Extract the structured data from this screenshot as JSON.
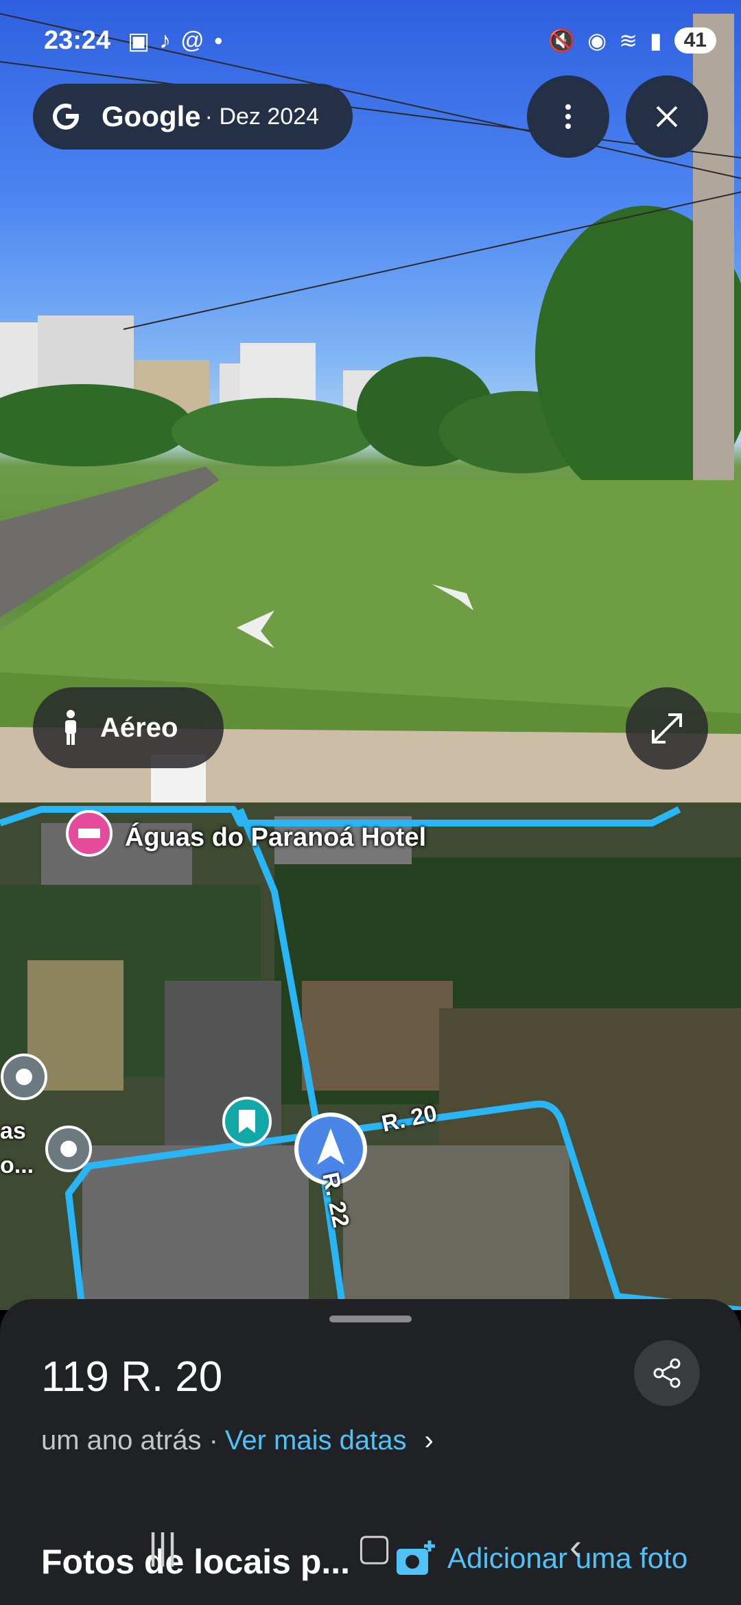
{
  "status_bar": {
    "time": "23:24",
    "battery": "41"
  },
  "street_view": {
    "brand": "Google",
    "date": "· Dez 2024",
    "aerial_label": "Aéreo"
  },
  "map": {
    "poi_hotel": "Águas do Paranoá Hotel",
    "road_r20": "R. 20",
    "road_r22": "R. 22",
    "partial_label_1": "as",
    "partial_label_2": "o..."
  },
  "sheet": {
    "address": "119 R. 20",
    "time_ago": "um ano atrás ·",
    "more_dates": "Ver mais datas",
    "photos_heading": "Fotos de locais p...",
    "add_photo": "Adicionar uma foto"
  },
  "colors": {
    "route_blue": "#29b6f6",
    "link_blue": "#4fc3f7",
    "sheet_bg": "#202124",
    "pill_bg": "#233046"
  }
}
